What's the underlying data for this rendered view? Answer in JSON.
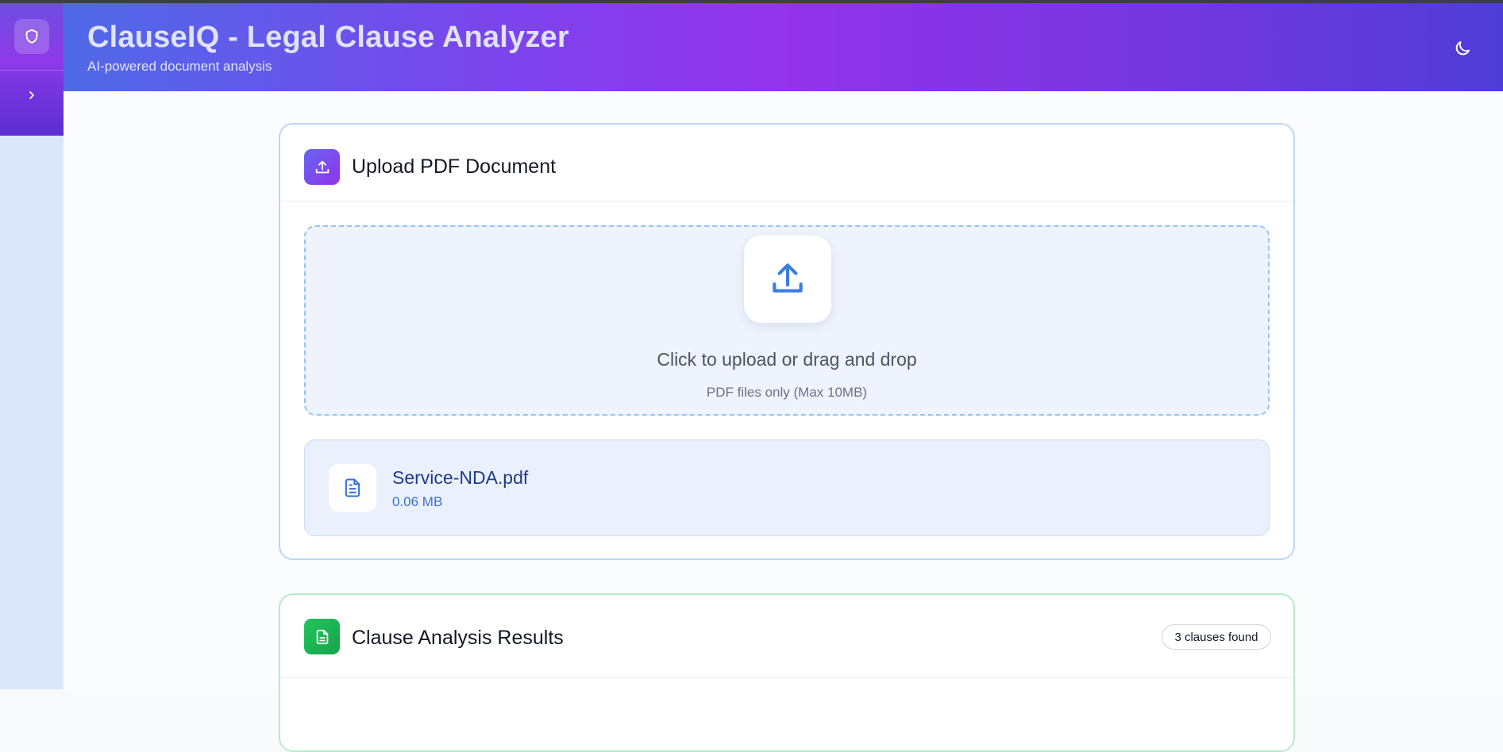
{
  "header": {
    "title": "ClauseIQ - Legal Clause Analyzer",
    "subtitle": "AI-powered document analysis"
  },
  "sidebar": {
    "logo_icon": "shield-icon",
    "toggle_icon": "chevron-right-icon"
  },
  "theme_toggle_icon": "moon-icon",
  "upload": {
    "title": "Upload PDF Document",
    "icon": "upload-icon",
    "dropzone": {
      "title": "Click to upload or drag and drop",
      "subtitle": "PDF files only (Max 10MB)",
      "icon": "upload-icon"
    },
    "file": {
      "name": "Service-NDA.pdf",
      "size": "0.06 MB",
      "icon": "file-text-icon"
    }
  },
  "results": {
    "title": "Clause Analysis Results",
    "icon": "file-text-icon",
    "count_badge": "3 clauses found"
  },
  "colors": {
    "header_gradient_start": "#4f6ae8",
    "header_gradient_mid": "#9333ea",
    "header_gradient_end": "#4f3cd6",
    "upload_accent": "#3b82f6",
    "results_accent": "#22c55e"
  }
}
